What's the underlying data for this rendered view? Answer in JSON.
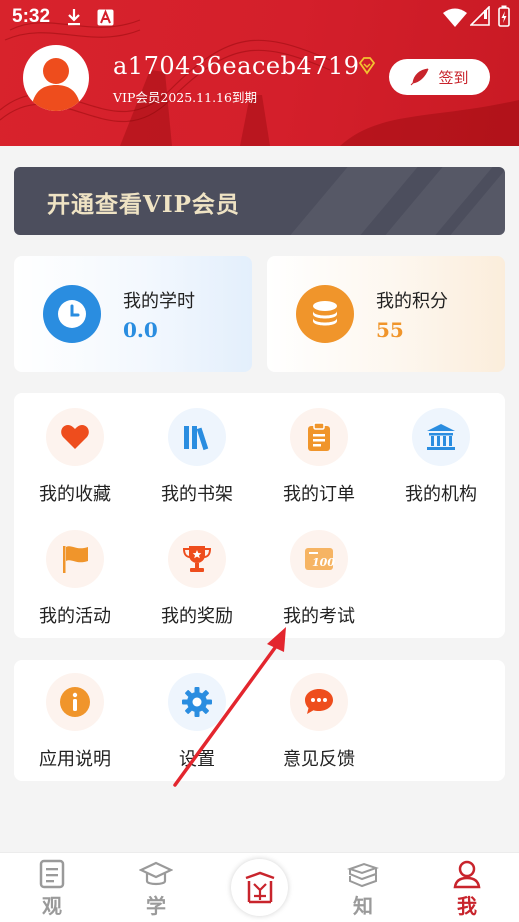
{
  "status_bar": {
    "time": "5:32",
    "icons": [
      "download-icon",
      "a-icon",
      "wifi-icon",
      "signal-icon",
      "battery-icon"
    ]
  },
  "profile": {
    "username": "a170436eaceb4719",
    "vip_expiry": "VIP会员2025.11.16到期",
    "checkin_label": "签到",
    "avatar_icon": "person-icon",
    "vip_icon": "diamond-icon"
  },
  "vip_banner": {
    "label": "开通查看VIP会员"
  },
  "stats": [
    {
      "title": "我的学时",
      "value": "0.0",
      "icon": "clock-icon",
      "color": "#2a8de0"
    },
    {
      "title": "我的积分",
      "value": "55",
      "icon": "coins-icon",
      "color": "#f0952b"
    }
  ],
  "menu_main": [
    {
      "label": "我的收藏",
      "icon": "heart-icon"
    },
    {
      "label": "我的书架",
      "icon": "bookshelf-icon"
    },
    {
      "label": "我的订单",
      "icon": "clipboard-icon"
    },
    {
      "label": "我的机构",
      "icon": "institution-icon"
    },
    {
      "label": "我的活动",
      "icon": "flag-icon"
    },
    {
      "label": "我的奖励",
      "icon": "trophy-icon"
    },
    {
      "label": "我的考试",
      "icon": "exam-icon"
    }
  ],
  "menu_secondary": [
    {
      "label": "应用说明",
      "icon": "info-icon"
    },
    {
      "label": "设置",
      "icon": "gear-icon"
    },
    {
      "label": "意见反馈",
      "icon": "chat-icon"
    }
  ],
  "bottom_nav": [
    {
      "label": "观",
      "icon": "document-icon",
      "active": false
    },
    {
      "label": "学",
      "icon": "graduation-cap-icon",
      "active": false
    },
    {
      "label": "",
      "icon": "seal-logo-icon",
      "active": false
    },
    {
      "label": "知",
      "icon": "books-icon",
      "active": false
    },
    {
      "label": "我",
      "icon": "user-icon",
      "active": true
    }
  ],
  "colors": {
    "brand_red": "#d41f2b",
    "accent_orange": "#f0952b",
    "accent_blue": "#2a8de0",
    "arrow_red": "#e3262e"
  }
}
